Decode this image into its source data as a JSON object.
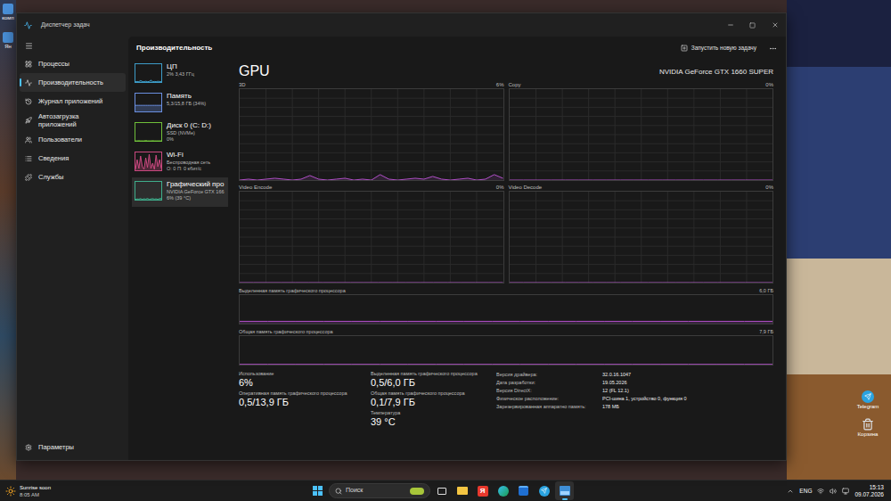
{
  "desktop": {
    "left_icons": [
      {
        "label": "комп"
      },
      {
        "label": "Ян"
      }
    ],
    "right_icons": [
      {
        "label": "Telegram"
      },
      {
        "label": "Корзина"
      }
    ]
  },
  "window": {
    "title": "Диспетчер задач"
  },
  "sidebar": {
    "items": [
      {
        "label": "Процессы",
        "selected": false
      },
      {
        "label": "Производительность",
        "selected": true
      },
      {
        "label": "Журнал приложений",
        "selected": false
      },
      {
        "label": "Автозагрузка приложений",
        "selected": false
      },
      {
        "label": "Пользователи",
        "selected": false
      },
      {
        "label": "Сведения",
        "selected": false
      },
      {
        "label": "Службы",
        "selected": false
      }
    ],
    "footer": "Параметры"
  },
  "header": {
    "title": "Производительность",
    "action": "Запустить новую задачу"
  },
  "resources": [
    {
      "name": "ЦП",
      "lines": [
        "2% 3,43 ГГц"
      ],
      "selected": false,
      "color": "#3d9cc8",
      "values": [
        2,
        3,
        2,
        8,
        3,
        2,
        4,
        2,
        3,
        10,
        2,
        3,
        2,
        4,
        3,
        2
      ]
    },
    {
      "name": "Память",
      "lines": [
        "5,3/15,8 ГБ (34%)"
      ],
      "selected": false,
      "color": "#6a8fe0",
      "values": [
        34,
        34,
        34,
        34,
        34,
        34,
        34,
        34,
        34,
        34,
        34,
        34,
        34,
        34,
        34,
        34
      ]
    },
    {
      "name": "Диск 0 (C: D:)",
      "lines": [
        "SSD (NVMe)",
        "0%"
      ],
      "selected": false,
      "color": "#6fbf3a",
      "values": [
        0,
        0,
        1,
        0,
        0,
        0,
        2,
        0,
        0,
        0,
        1,
        0,
        0,
        0,
        0,
        0
      ]
    },
    {
      "name": "Wi-Fi",
      "lines": [
        "Беспроводная сеть",
        "О: 0 П: 0 кбит/с"
      ],
      "selected": false,
      "color": "#c9487f",
      "values": [
        5,
        60,
        10,
        80,
        20,
        5,
        70,
        15,
        90,
        10,
        40,
        5,
        85,
        20,
        60,
        10
      ]
    },
    {
      "name": "Графический про",
      "lines": [
        "NVIDIA GeForce GTX 166",
        "6% (39 °C)"
      ],
      "selected": true,
      "color": "#3fae8c",
      "values": [
        2,
        4,
        3,
        6,
        2,
        5,
        3,
        7,
        2,
        4,
        6,
        3,
        5,
        2,
        6,
        6
      ]
    }
  ],
  "gpu": {
    "title": "GPU",
    "device": "NVIDIA GeForce GTX 1660 SUPER",
    "color": "#b150c8",
    "engines": [
      {
        "label": "3D",
        "reading": "6%",
        "values": [
          0,
          1,
          0,
          1,
          2,
          1,
          0,
          1,
          5,
          1,
          0,
          1,
          2,
          0,
          1,
          0,
          6,
          1,
          0,
          1,
          2,
          1,
          4,
          1,
          0,
          1,
          2,
          0,
          1,
          6,
          2
        ]
      },
      {
        "label": "Copy",
        "reading": "0%",
        "values": [
          0,
          0,
          0,
          0,
          0,
          0,
          0,
          0,
          0,
          0,
          0,
          0,
          0,
          0,
          0,
          0,
          0,
          0,
          0,
          0
        ]
      },
      {
        "label": "Video Encode",
        "reading": "0%",
        "values": [
          0,
          0,
          0,
          0,
          0,
          0,
          0,
          0,
          0,
          0,
          0,
          0,
          0,
          0,
          0,
          0,
          0,
          0,
          0,
          0
        ]
      },
      {
        "label": "Video Decode",
        "reading": "0%",
        "values": [
          0,
          0,
          0,
          0,
          0,
          0,
          0,
          0,
          0,
          0,
          0,
          0,
          0,
          0,
          0,
          0,
          0,
          0,
          0,
          0
        ]
      }
    ],
    "memory_charts": [
      {
        "label": "Выделенная память графического процессора",
        "max": "6,0 ГБ",
        "values": [
          8,
          8,
          8,
          8,
          8,
          8,
          8,
          8,
          8,
          8,
          8,
          8,
          8,
          8,
          8,
          8,
          8,
          8,
          8,
          8
        ]
      },
      {
        "label": "Общая память графического процессора",
        "max": "7,9 ГБ",
        "values": [
          1,
          1,
          1,
          1,
          1,
          1,
          1,
          1,
          1,
          1,
          1,
          1,
          1,
          1,
          1,
          1,
          1,
          1,
          1,
          1
        ]
      }
    ],
    "stats": [
      [
        {
          "label": "Использование",
          "value": "6%"
        },
        {
          "label": "Оперативная память графического процессора",
          "value": "0,5/13,9 ГБ"
        }
      ],
      [
        {
          "label": "Выделенная память графического процессора",
          "value": "0,5/6,0 ГБ"
        },
        {
          "label": "Общая память графического процессора",
          "value": "0,1/7,9 ГБ"
        },
        {
          "label": "Температура",
          "value": "39 °C"
        }
      ]
    ],
    "details": [
      {
        "label": "Версия драйвера:",
        "value": "32.0.16.1047"
      },
      {
        "label": "Дата разработки:",
        "value": "19.05.2026"
      },
      {
        "label": "Версия DirectX:",
        "value": "12 (FL 12.1)"
      },
      {
        "label": "Физическое расположение:",
        "value": "PCI-шина 1, устройство 0, функция 0"
      },
      {
        "label": "Зарезервированная аппаратно память:",
        "value": "178 МБ"
      }
    ]
  },
  "taskbar": {
    "weather": {
      "title": "Sunrise soon",
      "subtitle": "8:05 AM"
    },
    "search": {
      "placeholder": "Поиск"
    },
    "apps": [
      {
        "kind": "taskview",
        "active": false
      },
      {
        "kind": "explorer",
        "active": false
      },
      {
        "kind": "yandex",
        "glyph": "Я",
        "active": false
      },
      {
        "kind": "edge",
        "active": false
      },
      {
        "kind": "store",
        "active": false
      },
      {
        "kind": "telegram",
        "active": false
      },
      {
        "kind": "taskmgr",
        "active": true
      }
    ],
    "tray": {
      "language": "ENG",
      "time": "15:13",
      "date": "09.07.2026"
    }
  }
}
